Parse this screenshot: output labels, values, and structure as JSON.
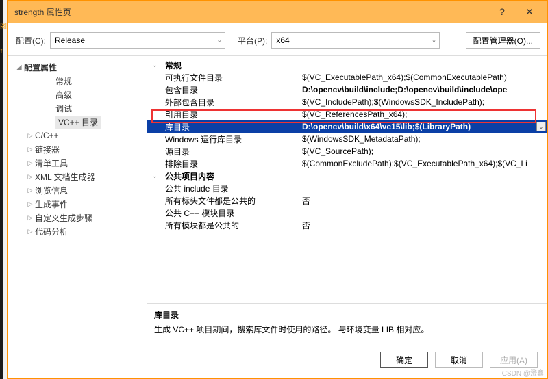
{
  "sideGlyphs": [
    "图",
    "t"
  ],
  "window": {
    "title": "strength 属性页",
    "help": "?",
    "close": "✕"
  },
  "top": {
    "configLabel": "配置(C):",
    "configValue": "Release",
    "platformLabel": "平台(P):",
    "platformValue": "x64",
    "managerBtn": "配置管理器(O)..."
  },
  "tree": [
    {
      "lvl": 0,
      "exp": "◢",
      "label": "配置属性",
      "bold": true
    },
    {
      "lvl": 2,
      "label": "常规"
    },
    {
      "lvl": 2,
      "label": "高级"
    },
    {
      "lvl": 2,
      "label": "调试"
    },
    {
      "lvl": 2,
      "label": "VC++ 目录",
      "sel": true
    },
    {
      "lvl": 1,
      "exp": "▷",
      "label": "C/C++"
    },
    {
      "lvl": 1,
      "exp": "▷",
      "label": "链接器"
    },
    {
      "lvl": 1,
      "exp": "▷",
      "label": "清单工具"
    },
    {
      "lvl": 1,
      "exp": "▷",
      "label": "XML 文档生成器"
    },
    {
      "lvl": 1,
      "exp": "▷",
      "label": "浏览信息"
    },
    {
      "lvl": 1,
      "exp": "▷",
      "label": "生成事件"
    },
    {
      "lvl": 1,
      "exp": "▷",
      "label": "自定义生成步骤"
    },
    {
      "lvl": 1,
      "exp": "▷",
      "label": "代码分析"
    }
  ],
  "grid": [
    {
      "type": "group",
      "exp": "⌄",
      "key": "常规"
    },
    {
      "key": "可执行文件目录",
      "val": "$(VC_ExecutablePath_x64);$(CommonExecutablePath)"
    },
    {
      "key": "包含目录",
      "val": "D:\\opencv\\build\\include;D:\\opencv\\build\\include\\ope",
      "bold": true
    },
    {
      "key": "外部包含目录",
      "val": "$(VC_IncludePath);$(WindowsSDK_IncludePath);"
    },
    {
      "key": "引用目录",
      "val": "$(VC_ReferencesPath_x64);"
    },
    {
      "key": "库目录",
      "val": "D:\\opencv\\build\\x64\\vc15\\lib;$(LibraryPath)",
      "bold": true,
      "sel": true
    },
    {
      "key": "Windows 运行库目录",
      "val": "$(WindowsSDK_MetadataPath);"
    },
    {
      "key": "源目录",
      "val": "$(VC_SourcePath);"
    },
    {
      "key": "排除目录",
      "val": "$(CommonExcludePath);$(VC_ExecutablePath_x64);$(VC_Li"
    },
    {
      "type": "group",
      "exp": "⌄",
      "key": "公共项目内容"
    },
    {
      "key": "公共 include 目录",
      "val": ""
    },
    {
      "key": "所有标头文件都是公共的",
      "val": "否"
    },
    {
      "key": "公共 C++ 模块目录",
      "val": ""
    },
    {
      "key": "所有模块都是公共的",
      "val": "否"
    }
  ],
  "desc": {
    "title": "库目录",
    "body": "生成 VC++ 项目期间，搜索库文件时使用的路径。   与环境变量 LIB 相对应。"
  },
  "footer": {
    "ok": "确定",
    "cancel": "取消",
    "apply": "应用(A)"
  },
  "watermark": "CSDN @澄鑫"
}
